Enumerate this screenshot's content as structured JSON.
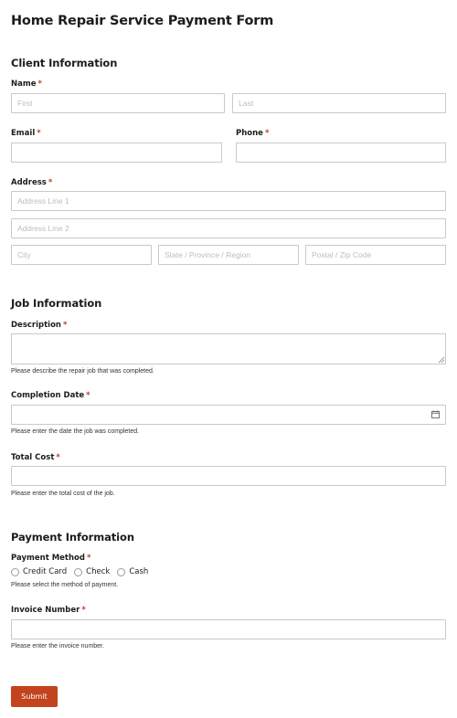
{
  "form": {
    "title": "Home Repair Service Payment Form",
    "required_marker": "*",
    "client_section": {
      "heading": "Client Information",
      "name_label": "Name",
      "first_placeholder": "First",
      "last_placeholder": "Last",
      "email_label": "Email",
      "phone_label": "Phone",
      "address_label": "Address",
      "address1_placeholder": "Address Line 1",
      "address2_placeholder": "Address Line 2",
      "city_placeholder": "City",
      "state_placeholder": "State / Province / Region",
      "zip_placeholder": "Postal / Zip Code"
    },
    "job_section": {
      "heading": "Job Information",
      "description_label": "Description",
      "description_help": "Please describe the repair job that was completed.",
      "date_label": "Completion Date",
      "date_help": "Please enter the date the job was completed.",
      "cost_label": "Total Cost",
      "cost_help": "Please enter the total cost of the job."
    },
    "payment_section": {
      "heading": "Payment Information",
      "method_label": "Payment Method",
      "method_options": [
        "Credit Card",
        "Check",
        "Cash"
      ],
      "method_help": "Please select the method of payment.",
      "invoice_label": "Invoice Number",
      "invoice_help": "Please enter the invoice number."
    },
    "submit_label": "Submit",
    "colors": {
      "accent": "#c2431e",
      "required": "#c0392b",
      "border": "#c9c9c9",
      "placeholder": "#bdbdbd"
    },
    "icons": {
      "date": "calendar-icon",
      "textarea_resize": "resize-grip-icon"
    }
  }
}
